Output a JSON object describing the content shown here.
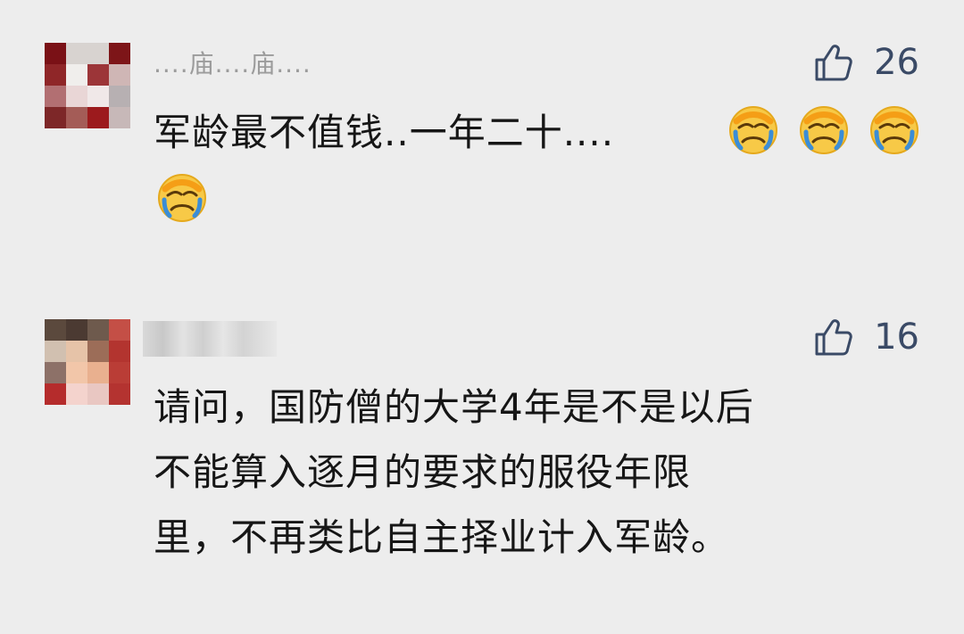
{
  "comments": [
    {
      "username": "....庙....庙....",
      "likes": "26",
      "text": "军龄最不值钱..一年二十....",
      "emoji_count": 4,
      "emoji_name": "face-palm-crying-emoji"
    },
    {
      "username": "",
      "likes": "16",
      "text": "请问，国防僧的大学4年是不是以后\n不能算入逐月的要求的服役年限\n里，不再类比自主择业计入军龄。"
    }
  ],
  "colors": {
    "background": "#ededed",
    "text": "#161616",
    "username": "#9c9c9c",
    "like": "#3a4a66"
  },
  "icons": {
    "like": "thumbs-up-outline-icon"
  }
}
